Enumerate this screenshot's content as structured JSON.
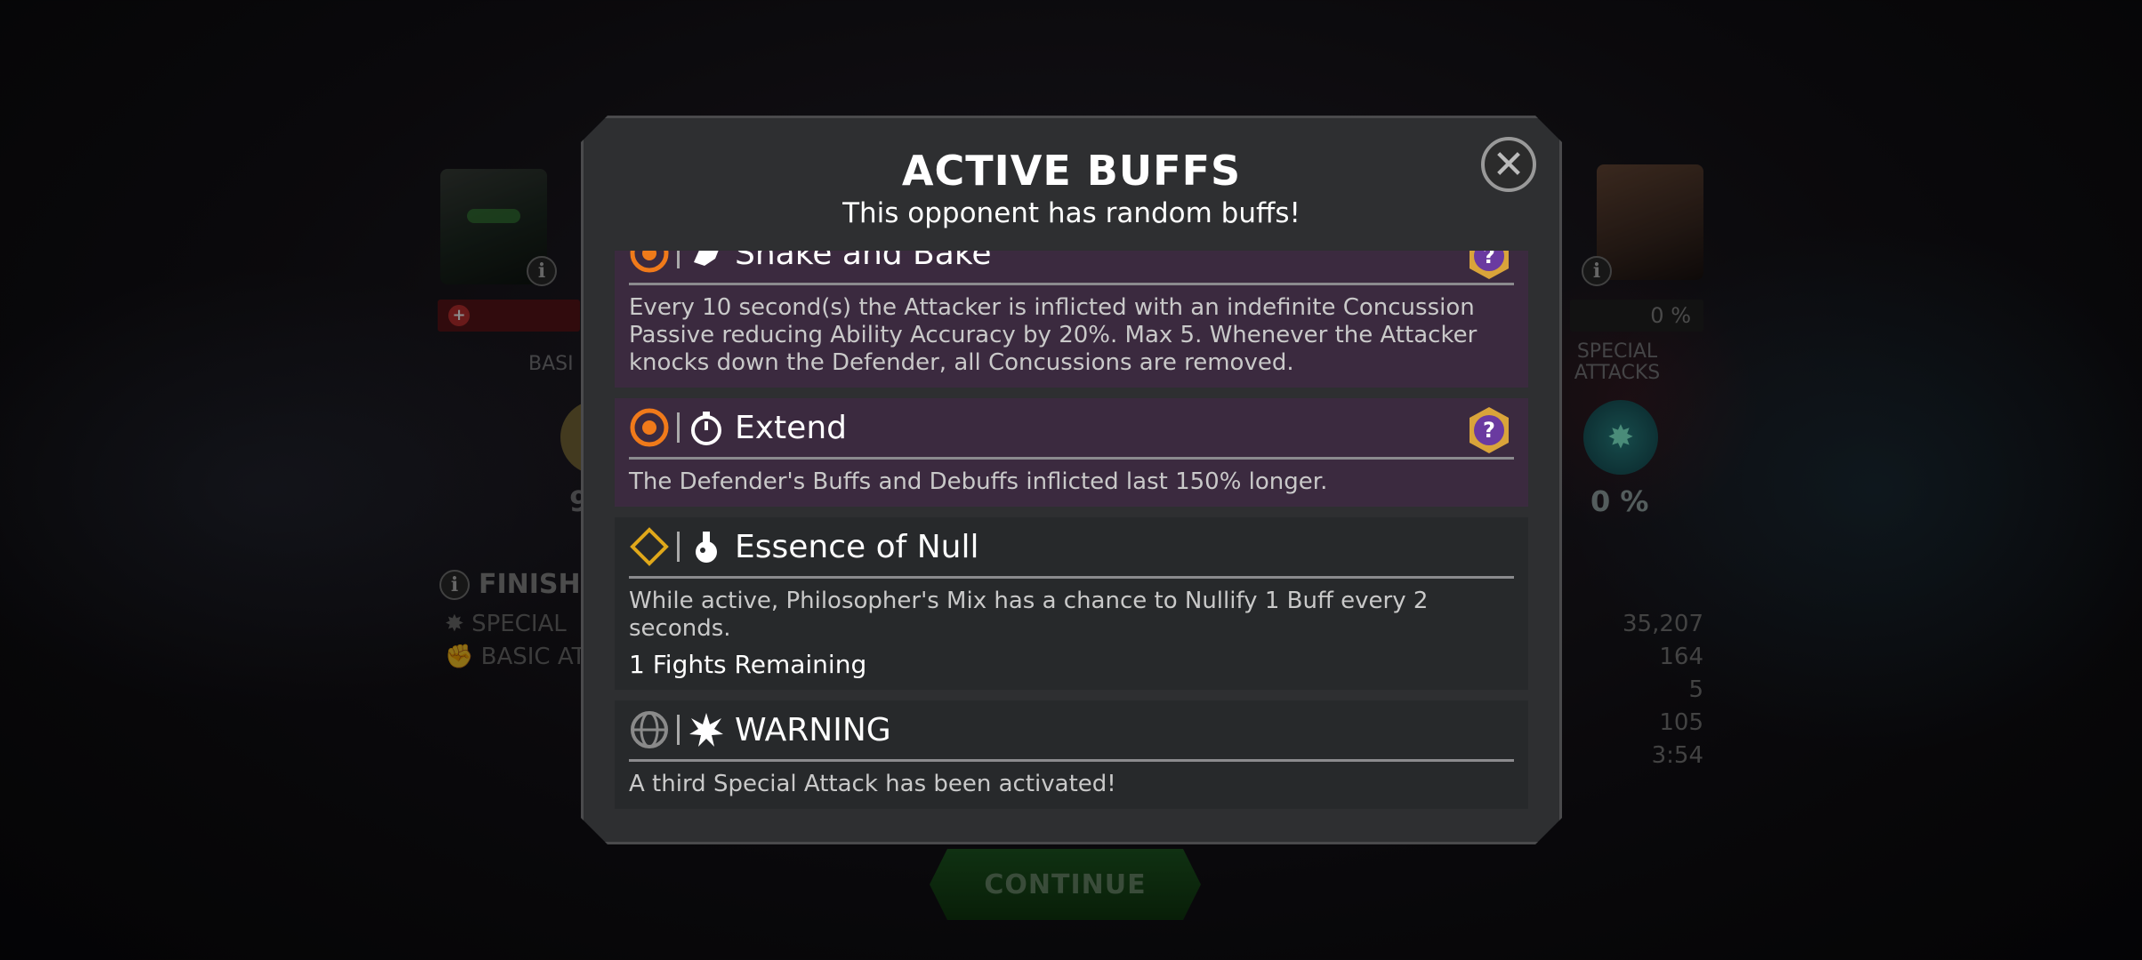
{
  "background": {
    "info_glyph": "i",
    "heart_glyph": "+",
    "left_basic_label": "BASI",
    "right_special_label": "SPECIAL\nATTACKS",
    "left_special_value": "9",
    "right_special_pct": "0 %",
    "right_hp_pct": "0 %",
    "finish_label": "FINISHI",
    "left_stats": [
      "SPECIAL",
      "BASIC AT"
    ],
    "right_stats": [
      "35,207",
      "164",
      "5",
      "105",
      "3:54"
    ],
    "continue_label": "CONTINUE"
  },
  "modal": {
    "title": "ACTIVE BUFFS",
    "subtitle": "This opponent has random buffs!",
    "close_glyph": "✕",
    "cards": [
      {
        "name": "Shake and Bake",
        "style": "purple",
        "type_icon": "orange-target-icon",
        "buff_icon": "punch-icon",
        "origin_badge": "question-badge-icon",
        "description": "Every 10 second(s) the Attacker is inflicted with an indefinite Concussion Passive reducing Ability Accuracy by 20%. Max 5. Whenever the Attacker knocks down the Defender, all Concussions are removed."
      },
      {
        "name": "Extend",
        "style": "purple",
        "type_icon": "orange-target-icon",
        "buff_icon": "stopwatch-icon",
        "origin_badge": "question-badge-icon",
        "description": "The Defender's Buffs and Debuffs inflicted last 150% longer."
      },
      {
        "name": "Essence of Null",
        "style": "dark",
        "type_icon": "yellow-diamond-icon",
        "buff_icon": "flask-icon",
        "description": "While active, Philosopher's Mix has a chance to Nullify 1 Buff every 2 seconds.",
        "remaining": "1 Fights Remaining"
      },
      {
        "name": "WARNING",
        "style": "dark",
        "type_icon": "grey-globe-icon",
        "buff_icon": "special-burst-icon",
        "description": "A third Special Attack has been activated!"
      }
    ]
  },
  "colors": {
    "modal_bg": "#2e2f31",
    "card_purple": "#3b2a3f",
    "card_dark": "#27292b",
    "accent_orange": "#f07a1a",
    "accent_yellow": "#e0a81a",
    "badge_gold": "#d9a43a",
    "badge_purple": "#6a3aa0"
  }
}
